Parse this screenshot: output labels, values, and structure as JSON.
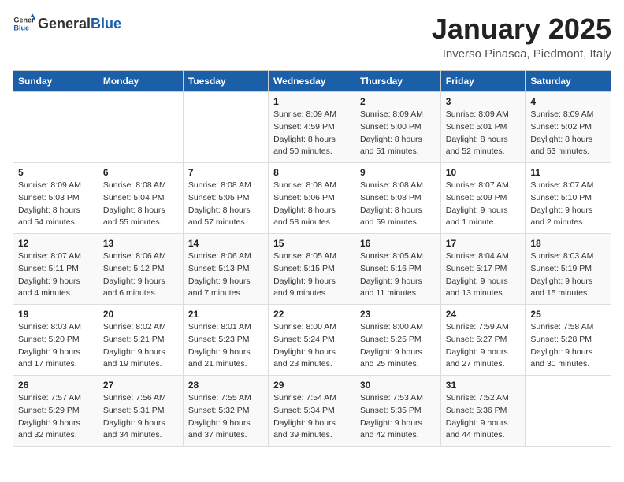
{
  "header": {
    "logo_general": "General",
    "logo_blue": "Blue",
    "month": "January 2025",
    "location": "Inverso Pinasca, Piedmont, Italy"
  },
  "weekdays": [
    "Sunday",
    "Monday",
    "Tuesday",
    "Wednesday",
    "Thursday",
    "Friday",
    "Saturday"
  ],
  "weeks": [
    [
      {
        "day": "",
        "sunrise": "",
        "sunset": "",
        "daylight": ""
      },
      {
        "day": "",
        "sunrise": "",
        "sunset": "",
        "daylight": ""
      },
      {
        "day": "",
        "sunrise": "",
        "sunset": "",
        "daylight": ""
      },
      {
        "day": "1",
        "sunrise": "Sunrise: 8:09 AM",
        "sunset": "Sunset: 4:59 PM",
        "daylight": "Daylight: 8 hours and 50 minutes."
      },
      {
        "day": "2",
        "sunrise": "Sunrise: 8:09 AM",
        "sunset": "Sunset: 5:00 PM",
        "daylight": "Daylight: 8 hours and 51 minutes."
      },
      {
        "day": "3",
        "sunrise": "Sunrise: 8:09 AM",
        "sunset": "Sunset: 5:01 PM",
        "daylight": "Daylight: 8 hours and 52 minutes."
      },
      {
        "day": "4",
        "sunrise": "Sunrise: 8:09 AM",
        "sunset": "Sunset: 5:02 PM",
        "daylight": "Daylight: 8 hours and 53 minutes."
      }
    ],
    [
      {
        "day": "5",
        "sunrise": "Sunrise: 8:09 AM",
        "sunset": "Sunset: 5:03 PM",
        "daylight": "Daylight: 8 hours and 54 minutes."
      },
      {
        "day": "6",
        "sunrise": "Sunrise: 8:08 AM",
        "sunset": "Sunset: 5:04 PM",
        "daylight": "Daylight: 8 hours and 55 minutes."
      },
      {
        "day": "7",
        "sunrise": "Sunrise: 8:08 AM",
        "sunset": "Sunset: 5:05 PM",
        "daylight": "Daylight: 8 hours and 57 minutes."
      },
      {
        "day": "8",
        "sunrise": "Sunrise: 8:08 AM",
        "sunset": "Sunset: 5:06 PM",
        "daylight": "Daylight: 8 hours and 58 minutes."
      },
      {
        "day": "9",
        "sunrise": "Sunrise: 8:08 AM",
        "sunset": "Sunset: 5:08 PM",
        "daylight": "Daylight: 8 hours and 59 minutes."
      },
      {
        "day": "10",
        "sunrise": "Sunrise: 8:07 AM",
        "sunset": "Sunset: 5:09 PM",
        "daylight": "Daylight: 9 hours and 1 minute."
      },
      {
        "day": "11",
        "sunrise": "Sunrise: 8:07 AM",
        "sunset": "Sunset: 5:10 PM",
        "daylight": "Daylight: 9 hours and 2 minutes."
      }
    ],
    [
      {
        "day": "12",
        "sunrise": "Sunrise: 8:07 AM",
        "sunset": "Sunset: 5:11 PM",
        "daylight": "Daylight: 9 hours and 4 minutes."
      },
      {
        "day": "13",
        "sunrise": "Sunrise: 8:06 AM",
        "sunset": "Sunset: 5:12 PM",
        "daylight": "Daylight: 9 hours and 6 minutes."
      },
      {
        "day": "14",
        "sunrise": "Sunrise: 8:06 AM",
        "sunset": "Sunset: 5:13 PM",
        "daylight": "Daylight: 9 hours and 7 minutes."
      },
      {
        "day": "15",
        "sunrise": "Sunrise: 8:05 AM",
        "sunset": "Sunset: 5:15 PM",
        "daylight": "Daylight: 9 hours and 9 minutes."
      },
      {
        "day": "16",
        "sunrise": "Sunrise: 8:05 AM",
        "sunset": "Sunset: 5:16 PM",
        "daylight": "Daylight: 9 hours and 11 minutes."
      },
      {
        "day": "17",
        "sunrise": "Sunrise: 8:04 AM",
        "sunset": "Sunset: 5:17 PM",
        "daylight": "Daylight: 9 hours and 13 minutes."
      },
      {
        "day": "18",
        "sunrise": "Sunrise: 8:03 AM",
        "sunset": "Sunset: 5:19 PM",
        "daylight": "Daylight: 9 hours and 15 minutes."
      }
    ],
    [
      {
        "day": "19",
        "sunrise": "Sunrise: 8:03 AM",
        "sunset": "Sunset: 5:20 PM",
        "daylight": "Daylight: 9 hours and 17 minutes."
      },
      {
        "day": "20",
        "sunrise": "Sunrise: 8:02 AM",
        "sunset": "Sunset: 5:21 PM",
        "daylight": "Daylight: 9 hours and 19 minutes."
      },
      {
        "day": "21",
        "sunrise": "Sunrise: 8:01 AM",
        "sunset": "Sunset: 5:23 PM",
        "daylight": "Daylight: 9 hours and 21 minutes."
      },
      {
        "day": "22",
        "sunrise": "Sunrise: 8:00 AM",
        "sunset": "Sunset: 5:24 PM",
        "daylight": "Daylight: 9 hours and 23 minutes."
      },
      {
        "day": "23",
        "sunrise": "Sunrise: 8:00 AM",
        "sunset": "Sunset: 5:25 PM",
        "daylight": "Daylight: 9 hours and 25 minutes."
      },
      {
        "day": "24",
        "sunrise": "Sunrise: 7:59 AM",
        "sunset": "Sunset: 5:27 PM",
        "daylight": "Daylight: 9 hours and 27 minutes."
      },
      {
        "day": "25",
        "sunrise": "Sunrise: 7:58 AM",
        "sunset": "Sunset: 5:28 PM",
        "daylight": "Daylight: 9 hours and 30 minutes."
      }
    ],
    [
      {
        "day": "26",
        "sunrise": "Sunrise: 7:57 AM",
        "sunset": "Sunset: 5:29 PM",
        "daylight": "Daylight: 9 hours and 32 minutes."
      },
      {
        "day": "27",
        "sunrise": "Sunrise: 7:56 AM",
        "sunset": "Sunset: 5:31 PM",
        "daylight": "Daylight: 9 hours and 34 minutes."
      },
      {
        "day": "28",
        "sunrise": "Sunrise: 7:55 AM",
        "sunset": "Sunset: 5:32 PM",
        "daylight": "Daylight: 9 hours and 37 minutes."
      },
      {
        "day": "29",
        "sunrise": "Sunrise: 7:54 AM",
        "sunset": "Sunset: 5:34 PM",
        "daylight": "Daylight: 9 hours and 39 minutes."
      },
      {
        "day": "30",
        "sunrise": "Sunrise: 7:53 AM",
        "sunset": "Sunset: 5:35 PM",
        "daylight": "Daylight: 9 hours and 42 minutes."
      },
      {
        "day": "31",
        "sunrise": "Sunrise: 7:52 AM",
        "sunset": "Sunset: 5:36 PM",
        "daylight": "Daylight: 9 hours and 44 minutes."
      },
      {
        "day": "",
        "sunrise": "",
        "sunset": "",
        "daylight": ""
      }
    ]
  ]
}
